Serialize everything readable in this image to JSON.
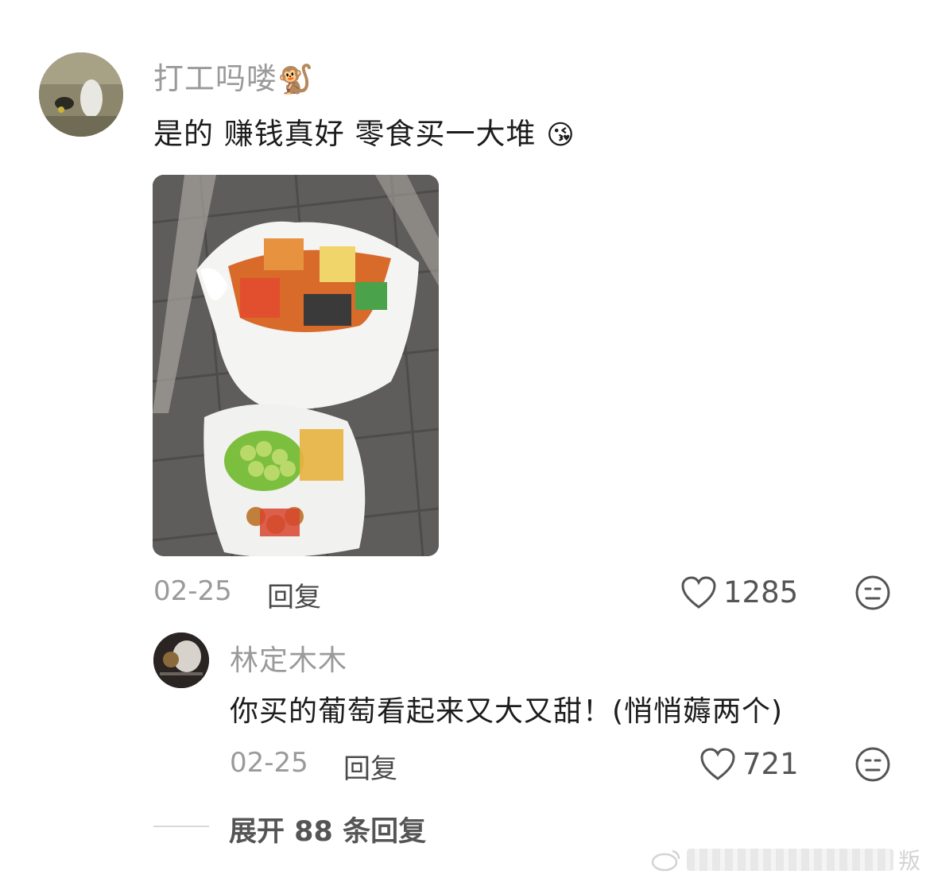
{
  "comment": {
    "username": "打工吗喽",
    "username_emoji": "🐒",
    "text": "是的 赚钱真好 零食买一大堆",
    "text_emoji": "😘",
    "date": "02-25",
    "reply_label": "回复",
    "likes": "1285"
  },
  "reply": {
    "username": "林定木木",
    "text": "你买的葡萄看起来又大又甜！(悄悄薅两个)",
    "date": "02-25",
    "reply_label": "回复",
    "likes": "721"
  },
  "expand": {
    "label": "展开 88 条回复"
  },
  "watermark": {
    "text": "叛"
  },
  "colors": {
    "username": "#9a9a9a",
    "body_text": "#1c1c1c",
    "meta": "#9a9a9a"
  }
}
